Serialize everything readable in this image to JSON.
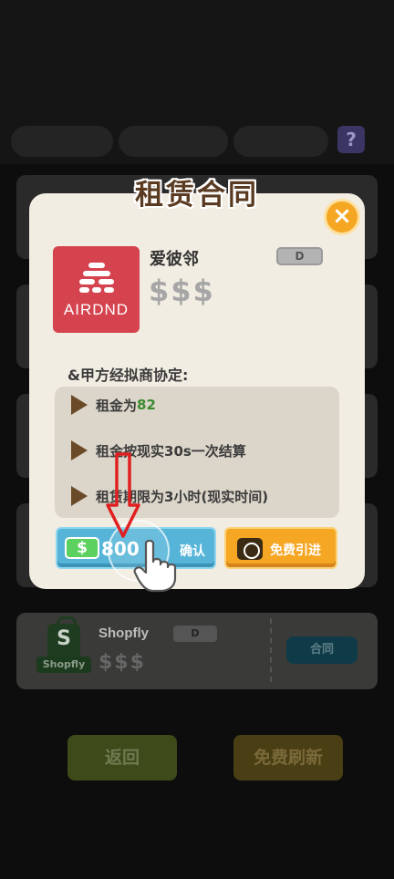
{
  "background": {
    "shopfly_card": {
      "logo_letter": "S",
      "logo_tag": "Shopfly",
      "name": "Shopfly",
      "grade": "D",
      "price_level": "$$$",
      "contract_button": "合同"
    },
    "back_button": "返回",
    "refresh_button": "免费刷新",
    "help_icon": "?"
  },
  "modal": {
    "title": "租赁合同",
    "close_icon": "×",
    "company": {
      "logo_text": "AIRDND",
      "name": "爱彼邻",
      "grade": "D",
      "price_level": "$$$"
    },
    "agreement_intro": "&甲方经拟商协定:",
    "terms": [
      {
        "prefix": "租金为",
        "value": "82"
      },
      {
        "prefix": "租金按现实30s一次结算",
        "value": ""
      },
      {
        "prefix": "租赁期限为3小时(现实时间)",
        "value": ""
      }
    ],
    "confirm_button": {
      "currency_icon": "$",
      "amount": "800",
      "label": "确认"
    },
    "free_button": {
      "label": "免费引进"
    }
  },
  "colors": {
    "modal_bg": "#f2ede2",
    "logo_red": "#d4434e",
    "confirm_blue": "#56b4d8",
    "free_orange": "#f5a623",
    "arrow_red": "#e02020",
    "rent_green": "#3c8a2f"
  },
  "icons": [
    "help-icon",
    "close-icon",
    "cash-icon",
    "video-icon",
    "play-triangle-icon",
    "hand-pointer-icon",
    "down-arrow-icon"
  ]
}
